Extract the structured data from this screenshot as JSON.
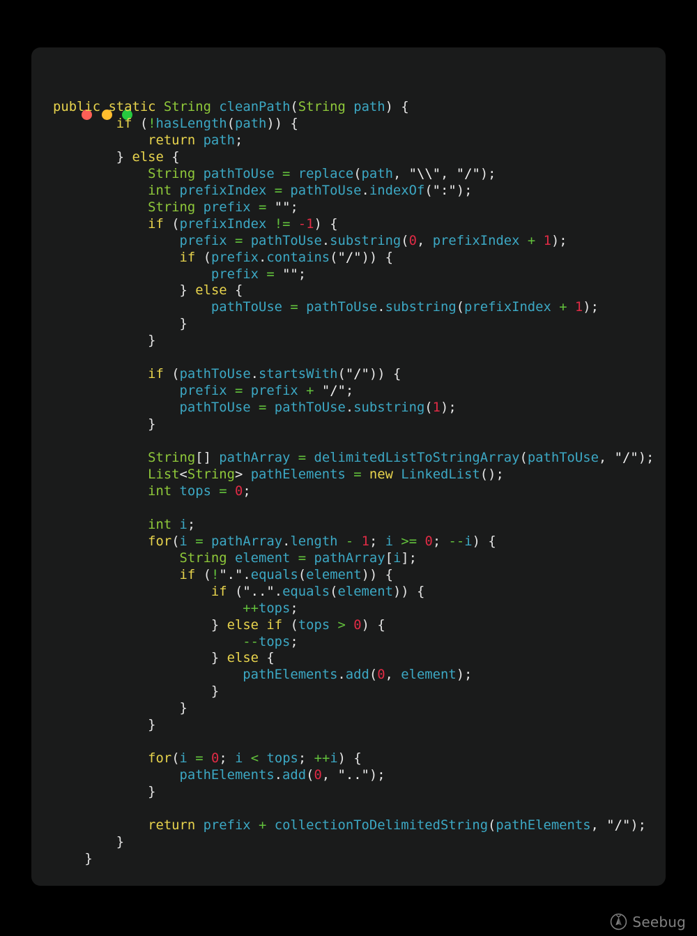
{
  "window": {
    "controls": [
      {
        "name": "close",
        "label": "Close",
        "color": "#ff5f56"
      },
      {
        "name": "minimize",
        "label": "Minimize",
        "color": "#ffbd2e"
      },
      {
        "name": "zoom",
        "label": "Zoom",
        "color": "#27c93f"
      }
    ],
    "background": "#1a1b1b",
    "page_background": "#000000"
  },
  "theme": {
    "keyword": "#e8d44d",
    "type": "#8fc93a",
    "identifier": "#3ca8c4",
    "number": "#e02b45",
    "string": "#f2f2f2",
    "operator": "#63c23c",
    "punctuation": "#e6e6e6",
    "foreground": "#e6e6e6"
  },
  "watermark": {
    "text": "Seebug",
    "icon": "bug-in-circle-icon"
  },
  "code": {
    "language": "java",
    "text": "public static String cleanPath(String path) {\n        if (!hasLength(path)) {\n            return path;\n        } else {\n            String pathToUse = replace(path, \"\\\\\\\\\", \"/\");\n            int prefixIndex = pathToUse.indexOf(\":\");\n            String prefix = \"\";\n            if (prefixIndex != -1) {\n                prefix = pathToUse.substring(0, prefixIndex + 1);\n                if (prefix.contains(\"/\")) {\n                    prefix = \"\";\n                } else {\n                    pathToUse = pathToUse.substring(prefixIndex + 1);\n                }\n            }\n\n            if (pathToUse.startsWith(\"/\")) {\n                prefix = prefix + \"/\";\n                pathToUse = pathToUse.substring(1);\n            }\n\n            String[] pathArray = delimitedListToStringArray(pathToUse, \"/\");\n            List<String> pathElements = new LinkedList();\n            int tops = 0;\n\n            int i;\n            for(i = pathArray.length - 1; i >= 0; --i) {\n                String element = pathArray[i];\n                if (!\".\".equals(element)) {\n                    if (\"..\".equals(element)) {\n                        ++tops;\n                    } else if (tops > 0) {\n                        --tops;\n                    } else {\n                        pathElements.add(0, element);\n                    }\n                }\n            }\n\n            for(i = 0; i < tops; ++i) {\n                pathElements.add(0, \"..\");\n            }\n\n            return prefix + collectionToDelimitedString(pathElements, \"/\");\n        }\n    }",
    "lines": [
      "public static String cleanPath(String path) {",
      "        if (!hasLength(path)) {",
      "            return path;",
      "        } else {",
      "            String pathToUse = replace(path, \"\\\\\", \"/\");",
      "            int prefixIndex = pathToUse.indexOf(\":\");",
      "            String prefix = \"\";",
      "            if (prefixIndex != -1) {",
      "                prefix = pathToUse.substring(0, prefixIndex + 1);",
      "                if (prefix.contains(\"/\")) {",
      "                    prefix = \"\";",
      "                } else {",
      "                    pathToUse = pathToUse.substring(prefixIndex + 1);",
      "                }",
      "            }",
      "",
      "            if (pathToUse.startsWith(\"/\")) {",
      "                prefix = prefix + \"/\";",
      "                pathToUse = pathToUse.substring(1);",
      "            }",
      "",
      "            String[] pathArray = delimitedListToStringArray(pathToUse, \"/\");",
      "            List<String> pathElements = new LinkedList();",
      "            int tops = 0;",
      "",
      "            int i;",
      "            for(i = pathArray.length - 1; i >= 0; --i) {",
      "                String element = pathArray[i];",
      "                if (!\".\".equals(element)) {",
      "                    if (\"..\".equals(element)) {",
      "                        ++tops;",
      "                    } else if (tops > 0) {",
      "                        --tops;",
      "                    } else {",
      "                        pathElements.add(0, element);",
      "                    }",
      "                }",
      "            }",
      "",
      "            for(i = 0; i < tops; ++i) {",
      "                pathElements.add(0, \"..\");",
      "            }",
      "",
      "            return prefix + collectionToDelimitedString(pathElements, \"/\");",
      "        }",
      "    }"
    ],
    "tokens": {
      "keywords": [
        "public",
        "static",
        "if",
        "else",
        "return",
        "for",
        "new"
      ],
      "types": [
        "String",
        "int",
        "List"
      ],
      "numbers": [
        "0",
        "1",
        "-1"
      ],
      "strings": [
        "\"\\\\\"",
        "\"/\"",
        "\"\"",
        "\":\"",
        "\".\"",
        "\"..\""
      ],
      "identifiers": [
        "cleanPath",
        "path",
        "hasLength",
        "pathToUse",
        "replace",
        "prefixIndex",
        "indexOf",
        "prefix",
        "substring",
        "contains",
        "startsWith",
        "pathArray",
        "delimitedListToStringArray",
        "pathElements",
        "LinkedList",
        "tops",
        "i",
        "length",
        "element",
        "equals",
        "add",
        "collectionToDelimitedString"
      ]
    }
  }
}
